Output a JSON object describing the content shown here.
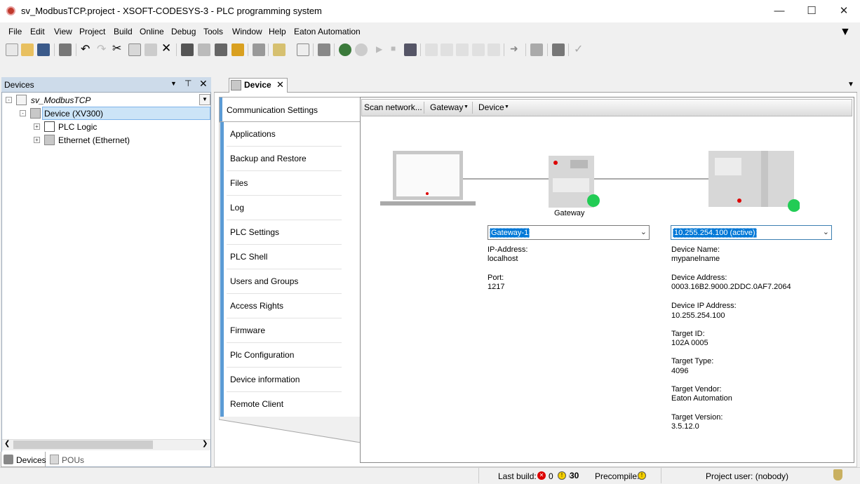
{
  "window": {
    "title": "sv_ModbusTCP.project - XSOFT-CODESYS-3 - PLC programming system"
  },
  "menu": [
    "File",
    "Edit",
    "View",
    "Project",
    "Build",
    "Online",
    "Debug",
    "Tools",
    "Window",
    "Help",
    "Eaton Automation"
  ],
  "devices_panel": {
    "title": "Devices",
    "tree": {
      "project": "sv_ModbusTCP",
      "device": "Device (XV300)",
      "children": [
        "PLC Logic",
        "Ethernet (Ethernet)"
      ]
    },
    "tabs": [
      "Devices",
      "POUs"
    ]
  },
  "editor": {
    "tab": "Device",
    "side_tabs": [
      "Communication Settings",
      "Applications",
      "Backup and Restore",
      "Files",
      "Log",
      "PLC Settings",
      "PLC Shell",
      "Users and Groups",
      "Access Rights",
      "Firmware",
      "Plc Configuration",
      "Device information",
      "Remote Client"
    ],
    "toolbar": {
      "scan": "Scan network...",
      "gateway": "Gateway",
      "device": "Device"
    },
    "gateway_label": "Gateway",
    "gateway": {
      "selected": "Gateway-1",
      "ip_label": "IP-Address:",
      "ip": "localhost",
      "port_label": "Port:",
      "port": "1217"
    },
    "device": {
      "selected": "10.255.254.100  (active)",
      "name_label": "Device Name:",
      "name": "mypanelname",
      "addr_label": "Device Address:",
      "addr": "0003.16B2.9000.2DDC.0AF7.2064",
      "ip_label": "Device IP Address:",
      "ip": "10.255.254.100",
      "tid_label": "Target ID:",
      "tid": "102A  0005",
      "ttype_label": "Target Type:",
      "ttype": "4096",
      "tvendor_label": "Target Vendor:",
      "tvendor": "Eaton Automation",
      "tversion_label": "Target Version:",
      "tversion": "3.5.12.0"
    }
  },
  "status": {
    "last_build": "Last build:",
    "errors": "0",
    "warnings": "0",
    "messages": "30",
    "precompile": "Precompile:",
    "user": "Project user: (nobody)"
  },
  "colors": {
    "accent": "#5b9bd5",
    "selection": "#0078d7",
    "online": "#22cc55"
  }
}
